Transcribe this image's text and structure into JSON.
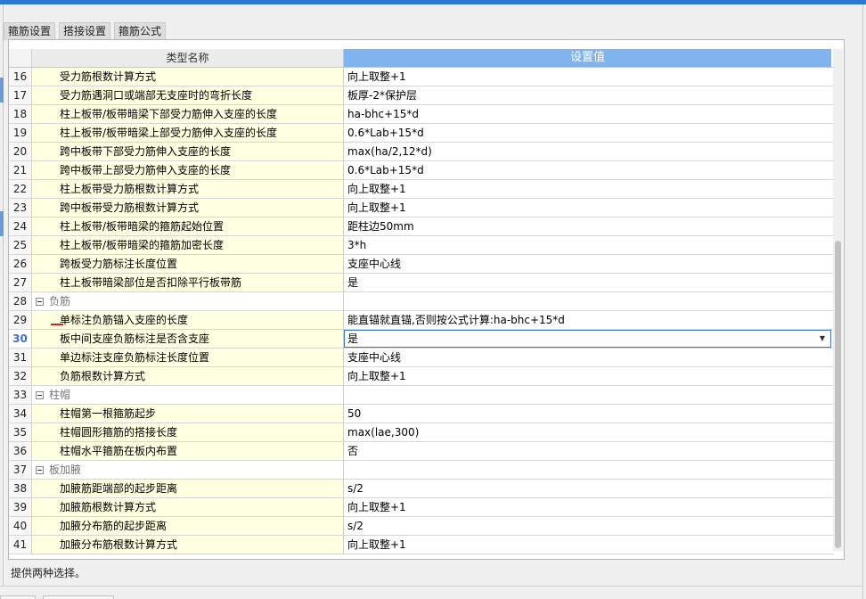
{
  "tabs": [
    "箍筋设置",
    "搭接设置",
    "箍筋公式"
  ],
  "grid": {
    "header_name": "类型名称",
    "header_value": "设置值",
    "rows": [
      {
        "num": "16",
        "name": "受力筋根数计算方式",
        "value": "向上取整+1"
      },
      {
        "num": "17",
        "name": "受力筋遇洞口或端部无支座时的弯折长度",
        "value": "板厚-2*保护层"
      },
      {
        "num": "18",
        "name": "柱上板带/板带暗梁下部受力筋伸入支座的长度",
        "value": "ha-bhc+15*d"
      },
      {
        "num": "19",
        "name": "柱上板带/板带暗梁上部受力筋伸入支座的长度",
        "value": "0.6*Lab+15*d"
      },
      {
        "num": "20",
        "name": "跨中板带下部受力筋伸入支座的长度",
        "value": "max(ha/2,12*d)"
      },
      {
        "num": "21",
        "name": "跨中板带上部受力筋伸入支座的长度",
        "value": "0.6*Lab+15*d"
      },
      {
        "num": "22",
        "name": "柱上板带受力筋根数计算方式",
        "value": "向上取整+1"
      },
      {
        "num": "23",
        "name": "跨中板带受力筋根数计算方式",
        "value": "向上取整+1"
      },
      {
        "num": "24",
        "name": "柱上板带/板带暗梁的箍筋起始位置",
        "value": "距柱边50mm"
      },
      {
        "num": "25",
        "name": "柱上板带/板带暗梁的箍筋加密长度",
        "value": "3*h"
      },
      {
        "num": "26",
        "name": "跨板受力筋标注长度位置",
        "value": "支座中心线"
      },
      {
        "num": "27",
        "name": "柱上板带暗梁部位是否扣除平行板带筋",
        "value": "是"
      },
      {
        "num": "28",
        "name": "负筋",
        "value": "",
        "group": true
      },
      {
        "num": "29",
        "name": "单标注负筋锚入支座的长度",
        "value": "能直锚就直锚,否则按公式计算:ha-bhc+15*d"
      },
      {
        "num": "30",
        "name": "板中间支座负筋标注是否含支座",
        "value": "是",
        "active": true
      },
      {
        "num": "31",
        "name": "单边标注支座负筋标注长度位置",
        "value": "支座中心线"
      },
      {
        "num": "32",
        "name": "负筋根数计算方式",
        "value": "向上取整+1"
      },
      {
        "num": "33",
        "name": "柱帽",
        "value": "",
        "group": true
      },
      {
        "num": "34",
        "name": "柱帽第一根箍筋起步",
        "value": "50"
      },
      {
        "num": "35",
        "name": "柱帽圆形箍筋的搭接长度",
        "value": "max(lae,300)"
      },
      {
        "num": "36",
        "name": "柱帽水平箍筋在板内布置",
        "value": "否"
      },
      {
        "num": "37",
        "name": "板加腋",
        "value": "",
        "group": true
      },
      {
        "num": "38",
        "name": "加腋筋距端部的起步距离",
        "value": "s/2"
      },
      {
        "num": "39",
        "name": "加腋筋根数计算方式",
        "value": "向上取整+1"
      },
      {
        "num": "40",
        "name": "加腋分布筋的起步距离",
        "value": "s/2"
      },
      {
        "num": "41",
        "name": "加腋分布筋根数计算方式",
        "value": "向上取整+1"
      }
    ]
  },
  "status_text": "提供两种选择。",
  "colors": {
    "header_accent": "#7fb4ee",
    "name_cell": "#ffffe1",
    "selection": "#3c78c8"
  }
}
